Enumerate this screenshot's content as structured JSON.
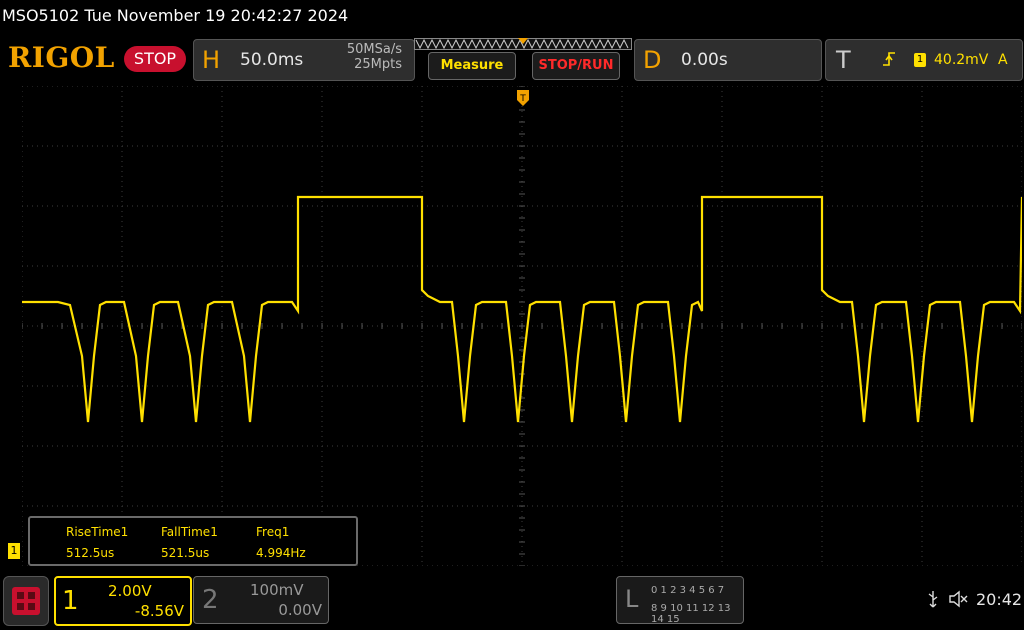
{
  "title_bar": {
    "text": "MSO5102  Tue November 19 20:42:27 2024"
  },
  "brand": {
    "logo": "RIGOL",
    "run_state": "STOP"
  },
  "horizontal": {
    "letter": "H",
    "timebase": "50.0ms",
    "sample_rate": "50MSa/s",
    "memory_depth": "25Mpts"
  },
  "buttons": {
    "measure": "Measure",
    "stop_run": "STOP/RUN"
  },
  "delay": {
    "letter": "D",
    "value": "0.00s"
  },
  "trigger": {
    "letter": "T",
    "channel": "1",
    "level": "40.2mV",
    "mode": "A"
  },
  "measurements": {
    "headers": [
      "RiseTime1",
      "FallTime1",
      "Freq1"
    ],
    "values": [
      "512.5us",
      "521.5us",
      "4.994Hz"
    ]
  },
  "channel1": {
    "number": "1",
    "scale": "2.00V",
    "offset": "-8.56V",
    "marker": "1"
  },
  "channel2": {
    "number": "2",
    "scale": "100mV",
    "offset": "0.00V"
  },
  "logic": {
    "letter": "L",
    "row1": "0 1 2 3  4 5 6 7",
    "row2": "8 9 10 11 12 13 14 15"
  },
  "status": {
    "clock": "20:42"
  },
  "icons": [
    "home-grid-icon",
    "usb-icon",
    "speaker-muted-icon",
    "trigger-edge-icon",
    "trigger-position-icon"
  ],
  "colors": {
    "trace": "#ffe000",
    "accent": "#f2a200",
    "stop": "#c8102e",
    "grid": "#3c3c3c"
  },
  "chart_data": {
    "type": "line",
    "title": "",
    "xlabel": "",
    "ylabel": "",
    "x_divisions": 10,
    "y_divisions": 8,
    "xlim": [
      -250,
      250
    ],
    "ylim": [
      -8,
      8
    ],
    "series": [
      {
        "x": [
          -250,
          -241,
          -232,
          -226,
          -220,
          -217,
          -214,
          -211,
          -208,
          -205,
          -199,
          -193,
          -190,
          -187,
          -184,
          -181,
          -178,
          -172,
          -166,
          -163,
          -160,
          -157,
          -154,
          -151,
          -145,
          -139,
          -136,
          -133,
          -130,
          -127,
          -124,
          -115,
          -112,
          -112,
          -50,
          -50,
          -47,
          -41,
          -35,
          -32,
          -29,
          -26,
          -23,
          -20,
          -14,
          -8,
          -5,
          -2,
          1,
          4,
          7,
          13,
          19,
          22,
          25,
          28,
          31,
          34,
          40,
          46,
          49,
          52,
          55,
          58,
          61,
          67,
          73,
          76,
          79,
          82,
          85,
          88,
          90,
          90,
          150,
          150,
          153,
          159,
          165,
          168,
          171,
          174,
          177,
          180,
          186,
          192,
          195,
          198,
          201,
          204,
          207,
          213,
          219,
          222,
          225,
          228,
          231,
          234,
          240,
          246,
          249,
          250
        ],
        "y": [
          0.8,
          0.8,
          0.8,
          0.7,
          -1,
          -3.2,
          -1,
          0.7,
          0.8,
          0.8,
          0.8,
          -1,
          -3.2,
          -1,
          0.7,
          0.8,
          0.8,
          0.8,
          -1,
          -3.2,
          -1,
          0.7,
          0.8,
          0.8,
          0.8,
          -1,
          -3.2,
          -1,
          0.7,
          0.8,
          0.8,
          0.8,
          0.5,
          4.3,
          4.3,
          1.2,
          1,
          0.8,
          0.8,
          -1,
          -3.2,
          -1,
          0.7,
          0.8,
          0.8,
          0.8,
          -1,
          -3.2,
          -1,
          0.7,
          0.8,
          0.8,
          0.8,
          -1,
          -3.2,
          -1,
          0.7,
          0.8,
          0.8,
          0.8,
          -1,
          -3.2,
          -1,
          0.7,
          0.8,
          0.8,
          0.8,
          -1,
          -3.2,
          -1,
          0.7,
          0.8,
          0.5,
          4.3,
          4.3,
          1.2,
          1,
          0.8,
          0.8,
          -1,
          -3.2,
          -1,
          0.7,
          0.8,
          0.8,
          0.8,
          -1,
          -3.2,
          -1,
          0.7,
          0.8,
          0.8,
          0.8,
          -1,
          -3.2,
          -1,
          0.7,
          0.8,
          0.8,
          0.8,
          0.5,
          4.3
        ]
      }
    ]
  }
}
